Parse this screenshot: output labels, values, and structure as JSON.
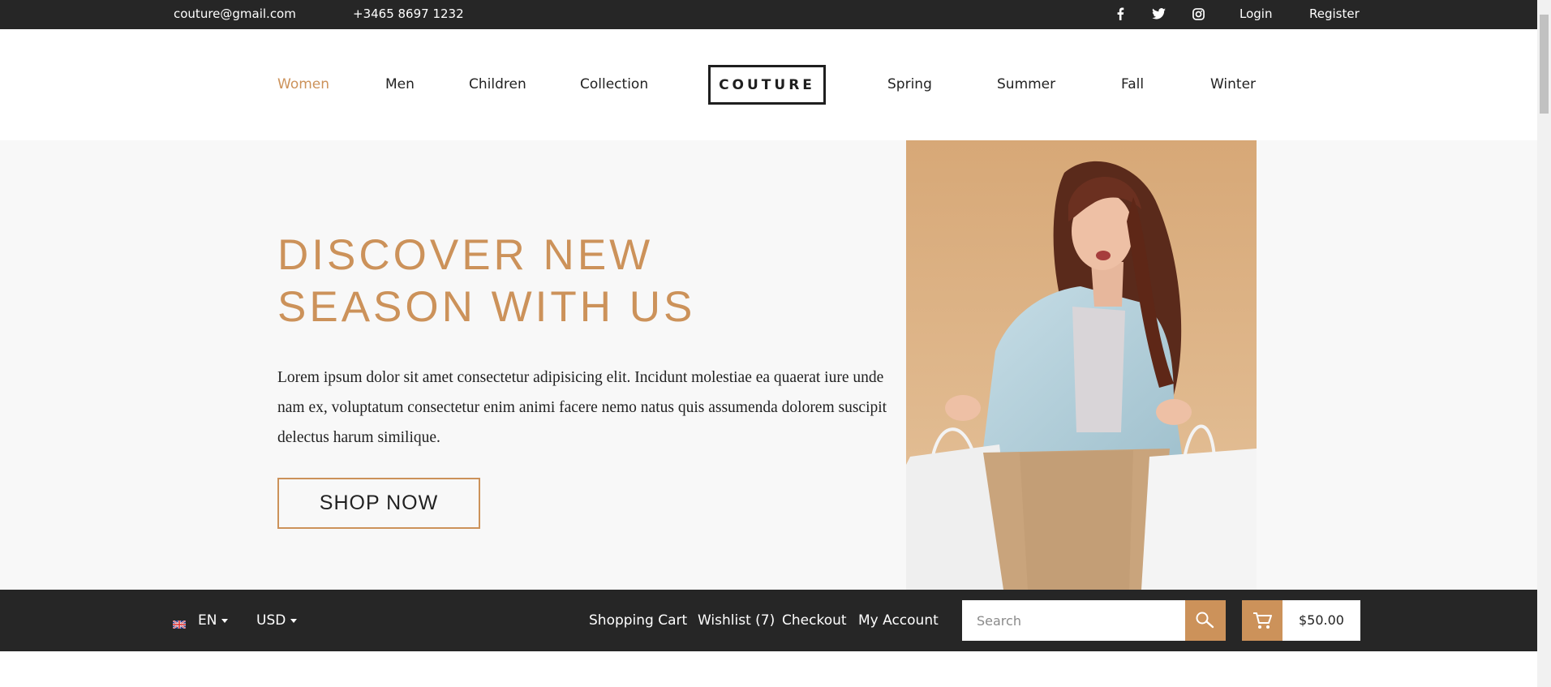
{
  "topbar": {
    "email": "couture@gmail.com",
    "phone": "+3465 8697 1232",
    "social": [
      "facebook-icon",
      "twitter-icon",
      "instagram-icon"
    ],
    "login": "Login",
    "register": "Register"
  },
  "nav": {
    "left": [
      "Women",
      "Men",
      "Children",
      "Collection"
    ],
    "logo": "COUTURE",
    "right": [
      "Spring",
      "Summer",
      "Fall",
      "Winter"
    ],
    "active": "Women"
  },
  "hero": {
    "title_line1": "DISCOVER NEW",
    "title_line2": "SEASON WITH US",
    "text": "Lorem ipsum dolor sit amet consectetur adipisicing elit. Incidunt molestiae ea quaerat iure unde nam ex, voluptatum consectetur enim animi facere nemo natus quis assumenda dolorem suscipit delectus harum similique.",
    "cta": "SHOP NOW"
  },
  "bottombar": {
    "language": "EN",
    "currency": "USD",
    "links": [
      "Shopping Cart",
      "Wishlist (7)",
      "Checkout",
      "My Account"
    ],
    "search_placeholder": "Search",
    "cart_total": "$50.00"
  },
  "colors": {
    "accent": "#cc925a",
    "dark": "#262626",
    "hero_bg": "#f8f8f8"
  }
}
